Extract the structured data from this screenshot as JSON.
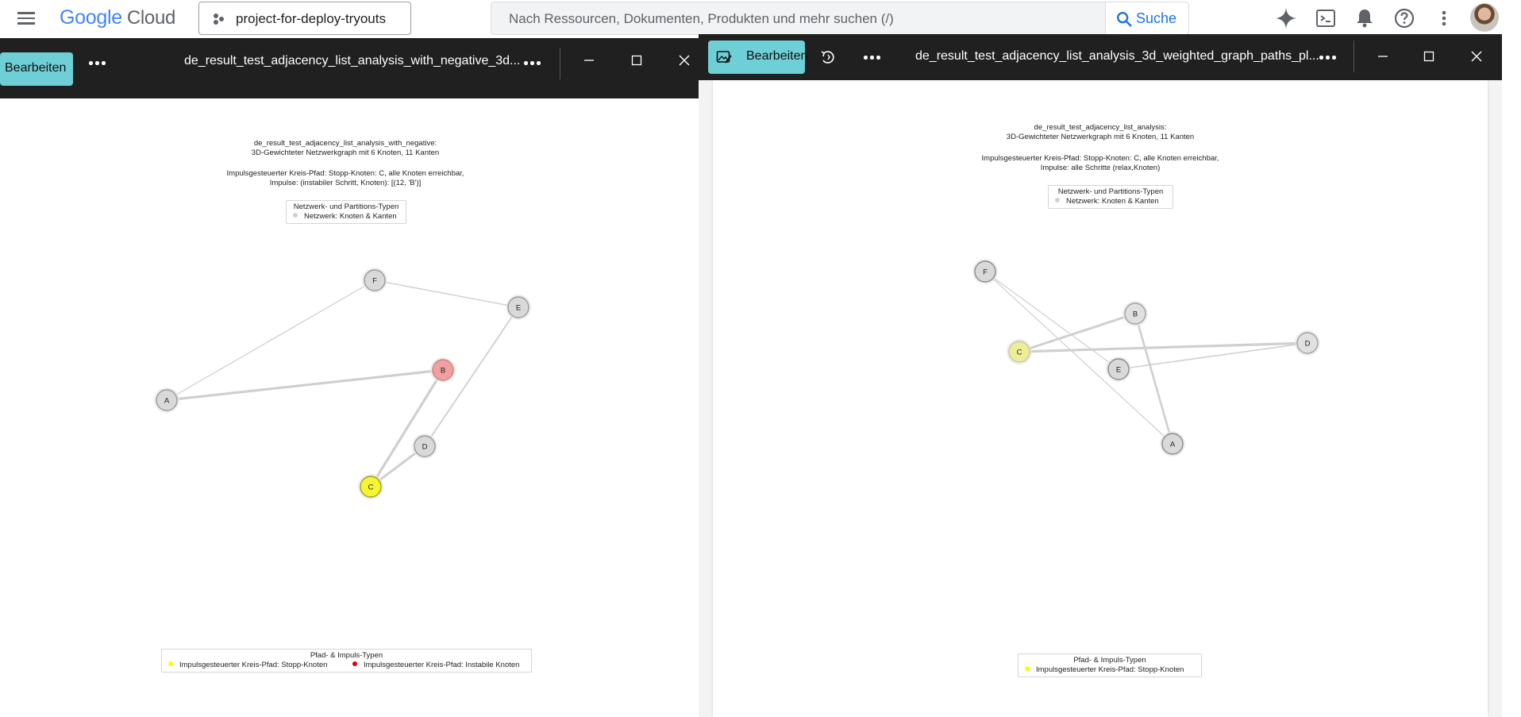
{
  "topbar": {
    "logo_google": "Google",
    "logo_cloud": "Cloud",
    "project_name": "project-for-deploy-tryouts",
    "search_placeholder": "Nach Ressourcen, Dokumenten, Produkten und mehr suchen (/)",
    "search_button": "Suche",
    "icons": [
      "menu-icon",
      "project-icon",
      "search-icon",
      "gemini-icon",
      "cloud-shell-icon",
      "notifications-icon",
      "help-icon",
      "more-vert-icon",
      "avatar"
    ]
  },
  "left_window": {
    "edit_label": "Bearbeiten",
    "title": "de_result_test_adjacency_list_analysis_with_negative_3d...",
    "plot": {
      "title_line1": "de_result_test_adjacency_list_analysis_with_negative:",
      "title_line2": "3D-Gewichteter Netzwerkgraph mit 6 Knoten, 11 Kanten",
      "subtitle_line1": "Impulsgesteuerter Kreis-Pfad: Stopp-Knoten: C, alle Knoten erreichbar,",
      "subtitle_line2": "Impulse: (instabiler Schritt, Knoten): [(12, 'B')]",
      "legend_top_title": "Netzwerk- und Partitions-Typen",
      "legend_top_item": "Netzwerk: Knoten & Kanten",
      "legend_bottom_title": "Pfad- & Impuls-Typen",
      "legend_bottom_item1": "Impulsgesteuerter Kreis-Pfad: Stopp-Knoten",
      "legend_bottom_item2": "Impulsgesteuerter Kreis-Pfad: Instabile Knoten"
    }
  },
  "right_window": {
    "edit_label": "Bearbeiten",
    "title": "de_result_test_adjacency_list_analysis_3d_weighted_graph_paths_pl...",
    "plot": {
      "title_line1": "de_result_test_adjacency_list_analysis:",
      "title_line2": "3D-Gewichteter Netzwerkgraph mit 6 Knoten, 11 Kanten",
      "subtitle_line1": "Impulsgesteuerter Kreis-Pfad: Stopp-Knoten: C, alle Knoten erreichbar,",
      "subtitle_line2": "Impulse: alle Schritte (relax,Knoten)",
      "legend_top_title": "Netzwerk- und Partitions-Typen",
      "legend_top_item": "Netzwerk: Knoten & Kanten",
      "legend_bottom_title": "Pfad- & Impuls-Typen",
      "legend_bottom_item1": "Impulsgesteuerter Kreis-Pfad: Stopp-Knoten"
    }
  },
  "colors": {
    "node_default": "#d9d9d9",
    "node_stop": "#f5f532",
    "node_stop_faded": "#eeee99",
    "node_unstable": "#f0a0a0",
    "legend_stop": "#ffff00",
    "legend_unstable": "#e00000",
    "legend_network": "#d0d0d0",
    "edit_button": "#6fcfd6"
  },
  "graphs": {
    "left": {
      "nodes": [
        {
          "id": "F",
          "label": "F",
          "fill": "#d9d9d9",
          "stroke": "#9a9a9a"
        },
        {
          "id": "E",
          "label": "E",
          "fill": "#d9d9d9",
          "stroke": "#9a9a9a"
        },
        {
          "id": "B",
          "label": "B",
          "fill": "#f0a0a0",
          "stroke": "#d08080"
        },
        {
          "id": "A",
          "label": "A",
          "fill": "#d9d9d9",
          "stroke": "#9a9a9a"
        },
        {
          "id": "D",
          "label": "D",
          "fill": "#d9d9d9",
          "stroke": "#9a9a9a"
        },
        {
          "id": "C",
          "label": "C",
          "fill": "#f5f532",
          "stroke": "#a0a020"
        }
      ],
      "edges": [
        [
          "F",
          "E"
        ],
        [
          "F",
          "A"
        ],
        [
          "A",
          "B"
        ],
        [
          "B",
          "C"
        ],
        [
          "E",
          "D"
        ],
        [
          "D",
          "C"
        ]
      ]
    },
    "right": {
      "nodes": [
        {
          "id": "F",
          "label": "F",
          "fill": "#d9d9d9",
          "stroke": "#8a8a8a"
        },
        {
          "id": "B",
          "label": "B",
          "fill": "#e0e0e0",
          "stroke": "#a0a0a0"
        },
        {
          "id": "C",
          "label": "C",
          "fill": "#eeee99",
          "stroke": "#c8c8a8"
        },
        {
          "id": "D",
          "label": "D",
          "fill": "#e0e0e0",
          "stroke": "#a0a0a0"
        },
        {
          "id": "E",
          "label": "E",
          "fill": "#d9d9d9",
          "stroke": "#8a8a8a"
        },
        {
          "id": "A",
          "label": "A",
          "fill": "#d9d9d9",
          "stroke": "#8a8a8a"
        }
      ],
      "edges": [
        [
          "F",
          "E"
        ],
        [
          "F",
          "A"
        ],
        [
          "C",
          "B"
        ],
        [
          "C",
          "D"
        ],
        [
          "E",
          "D"
        ],
        [
          "B",
          "A"
        ]
      ]
    }
  }
}
